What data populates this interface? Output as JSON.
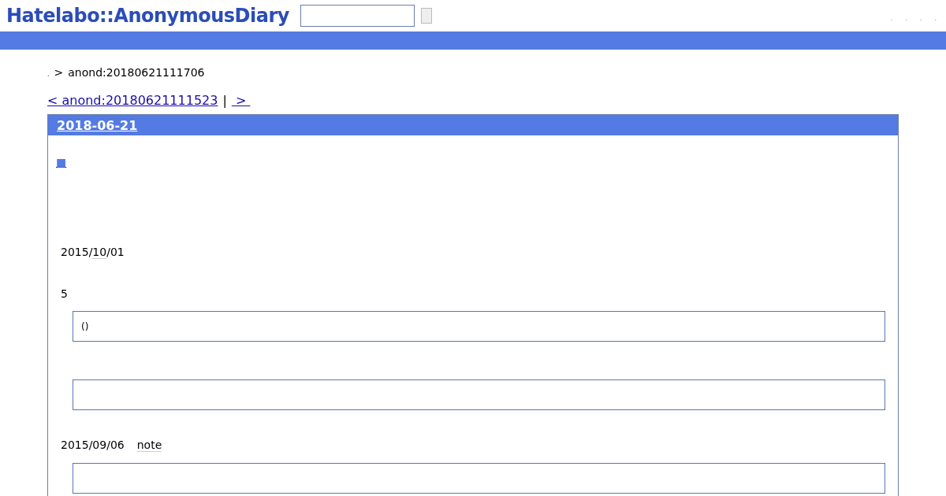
{
  "header": {
    "logo": "Hatelabo::AnonymousDiary",
    "nav_links": [
      ".",
      ".",
      ".",
      "."
    ]
  },
  "breadcrumb": {
    "home": ".",
    "separator": ">",
    "current": "anond:20180621111706"
  },
  "pager": {
    "prev": "< anond:20180621111523",
    "separator": "|",
    "next": " > "
  },
  "section": {
    "date": "2018-06-21",
    "anchor": "■",
    "blocks": [
      {
        "kind": "paragraph",
        "parts": [
          {
            "text": "2015/",
            "keyword": false
          },
          {
            "text": "10",
            "keyword": true
          },
          {
            "text": "/01",
            "keyword": false
          }
        ]
      },
      {
        "kind": "paragraph",
        "parts": [
          {
            "text": "5",
            "keyword": false
          }
        ]
      },
      {
        "kind": "quote",
        "text": "()"
      },
      {
        "kind": "quote"
      },
      {
        "kind": "paragraph",
        "parts": [
          {
            "text": "2015/09/06",
            "keyword": false
          },
          {
            "text": "note",
            "keyword": true
          }
        ]
      },
      {
        "kind": "quote"
      }
    ]
  }
}
